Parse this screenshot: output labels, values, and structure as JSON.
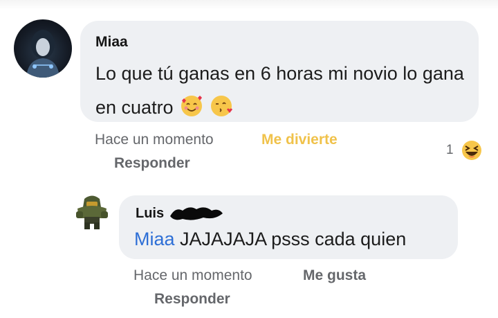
{
  "comment1": {
    "author": "Miaa",
    "text": "Lo que tú ganas en 6 horas mi novio lo gana en cuatro",
    "emojis": [
      "smiling-face-with-hearts-icon",
      "face-blowing-kiss-icon"
    ],
    "time": "Hace un momento",
    "reaction_label": "Me divierte",
    "reply_label": "Responder",
    "reaction_count": "1",
    "reaction_icon": "haha-reaction-icon",
    "reaction_color": "#f0c24b"
  },
  "comment2": {
    "author": "Luis",
    "mention": "Miaa",
    "text": "JAJAJAJA psss cada quien",
    "time": "Hace un momento",
    "like_label": "Me gusta",
    "reply_label": "Responder",
    "mention_color": "#2e6fd6"
  }
}
